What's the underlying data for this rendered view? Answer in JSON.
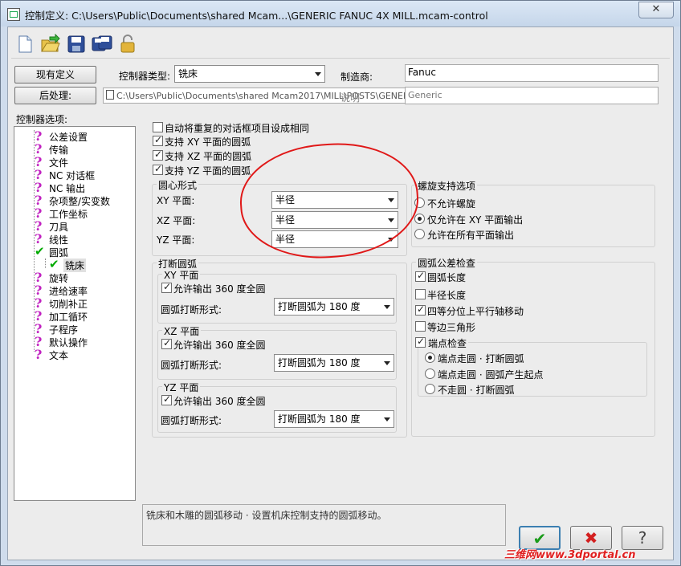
{
  "window": {
    "title": "控制定义: C:\\Users\\Public\\Documents\\shared Mcam...\\GENERIC FANUC 4X MILL.mcam-control",
    "close_glyph": "✕"
  },
  "toolbar": {
    "icons": [
      "new-file-icon",
      "open-folder-icon",
      "save-icon",
      "save-as-icon",
      "lock-icon"
    ]
  },
  "header": {
    "current_def_button": "现有定义",
    "post_button": "后处理:",
    "controller_type_label": "控制器类型:",
    "controller_type_value": "铣床",
    "manufacturer_label": "制造商:",
    "manufacturer_value": "Fanuc",
    "post_path": "C:\\Users\\Public\\Documents\\shared Mcam2017\\MILL\\POSTS\\GENERIC FANUC 4X MILL.pst",
    "description_label": "说明",
    "description_value": "Generic"
  },
  "tree": {
    "label": "控制器选项:",
    "items": [
      {
        "label": "公差设置",
        "icon": "question-icon"
      },
      {
        "label": "传输",
        "icon": "question-icon"
      },
      {
        "label": "文件",
        "icon": "question-icon"
      },
      {
        "label": "NC 对话框",
        "icon": "question-icon"
      },
      {
        "label": "NC 输出",
        "icon": "question-icon"
      },
      {
        "label": "杂项整/实变数",
        "icon": "question-icon"
      },
      {
        "label": "工作坐标",
        "icon": "question-icon"
      },
      {
        "label": "刀具",
        "icon": "question-icon"
      },
      {
        "label": "线性",
        "icon": "question-icon"
      },
      {
        "label": "圆弧",
        "icon": "check-icon"
      },
      {
        "label": "铣床",
        "icon": "check-icon",
        "child": true,
        "selected": true
      },
      {
        "label": "旋转",
        "icon": "question-icon"
      },
      {
        "label": "进给速率",
        "icon": "question-icon"
      },
      {
        "label": "切削补正",
        "icon": "question-icon"
      },
      {
        "label": "加工循环",
        "icon": "question-icon"
      },
      {
        "label": "子程序",
        "icon": "question-icon"
      },
      {
        "label": "默认操作",
        "icon": "question-icon"
      },
      {
        "label": "文本",
        "icon": "question-icon"
      }
    ]
  },
  "arc": {
    "auto_same": {
      "label": "自动将重复的对话框项目设成相同",
      "checked": false
    },
    "support_xy": {
      "label": "支持 XY 平面的圆弧",
      "checked": true
    },
    "support_xz": {
      "label": "支持 XZ 平面的圆弧",
      "checked": true
    },
    "support_yz": {
      "label": "支持 YZ 平面的圆弧",
      "checked": true
    },
    "center_group": {
      "title": "圆心形式",
      "rows": [
        {
          "label": "XY 平面:",
          "value": "半径"
        },
        {
          "label": "XZ 平面:",
          "value": "半径"
        },
        {
          "label": "YZ 平面:",
          "value": "半径"
        }
      ]
    },
    "helix_group": {
      "title": "螺旋支持选项",
      "options": [
        {
          "label": "不允许螺旋",
          "selected": false
        },
        {
          "label": "仅允许在 XY 平面输出",
          "selected": true
        },
        {
          "label": "允许在所有平面输出",
          "selected": false
        }
      ]
    },
    "break_group": {
      "title": "打断圆弧",
      "planes": [
        {
          "title": "XY 平面",
          "allow_label": "允许输出 360 度全圆",
          "allow_checked": true,
          "form_label": "圆弧打断形式:",
          "form_value": "打断圆弧为 180 度"
        },
        {
          "title": "XZ 平面",
          "allow_label": "允许输出 360 度全圆",
          "allow_checked": true,
          "form_label": "圆弧打断形式:",
          "form_value": "打断圆弧为 180 度"
        },
        {
          "title": "YZ 平面",
          "allow_label": "允许输出 360 度全圆",
          "allow_checked": true,
          "form_label": "圆弧打断形式:",
          "form_value": "打断圆弧为 180 度"
        }
      ]
    },
    "tolerance_group": {
      "title": "圆弧公差检查",
      "checks": [
        {
          "label": "圆弧长度",
          "checked": true
        },
        {
          "label": "半径长度",
          "checked": false
        },
        {
          "label": "四等分位上平行轴移动",
          "checked": true
        },
        {
          "label": "等边三角形",
          "checked": false
        }
      ],
      "endpoint": {
        "label": "端点检查",
        "checked": true,
        "options": [
          {
            "label": "端点走圆 · 打断圆弧",
            "selected": true
          },
          {
            "label": "端点走圆 · 圆弧产生起点",
            "selected": false
          },
          {
            "label": "不走圆 · 打断圆弧",
            "selected": false
          }
        ]
      }
    }
  },
  "help_text": "铣床和木雕的圆弧移动 · 设置机床控制支持的圆弧移动。",
  "buttons": {
    "ok": "✔",
    "cancel": "✖",
    "help": "?"
  },
  "watermark": "三维网www.3dportal.cn"
}
